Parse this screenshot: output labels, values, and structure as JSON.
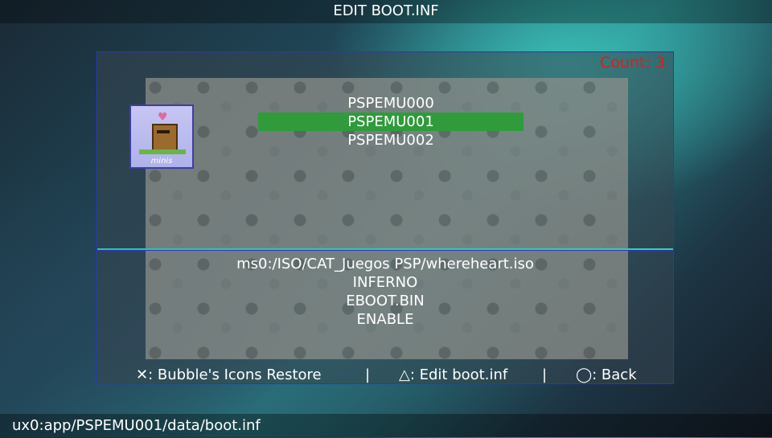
{
  "header": {
    "title": "EDIT BOOT.INF"
  },
  "panel": {
    "count_label": "Count: 3",
    "app_icon": {
      "name": "minis-game-icon",
      "caption": "minis"
    },
    "boot_entries": [
      {
        "label": "PSPEMU000",
        "selected": false
      },
      {
        "label": "PSPEMU001",
        "selected": true
      },
      {
        "label": "PSPEMU002",
        "selected": false
      }
    ],
    "details": {
      "path": "ms0:/ISO/CAT_Juegos PSP/whereheart.iso",
      "driver": "INFERNO",
      "execute": "EBOOT.BIN",
      "state": "ENABLE"
    },
    "controls": {
      "cross": "✕: Bubble's Icons Restore",
      "sep1": "|",
      "triangle": "△: Edit boot.inf",
      "sep2": "|",
      "circle": "◯: Back"
    }
  },
  "status_bar": {
    "path": "ux0:app/PSPEMU001/data/boot.inf"
  },
  "colors": {
    "selection": "#2f9b3a",
    "count": "#e21b1b",
    "panel_border": "#2b35c9",
    "divider": "#2ec4a5"
  }
}
